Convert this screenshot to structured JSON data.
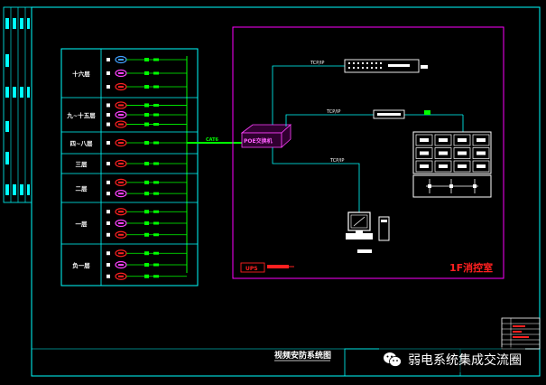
{
  "floors": [
    {
      "label": "十六层"
    },
    {
      "label": "九~十五层"
    },
    {
      "label": "四~八层"
    },
    {
      "label": "三层"
    },
    {
      "label": "二层"
    },
    {
      "label": "一层"
    },
    {
      "label": "负一层"
    }
  ],
  "trunk_label": "CAT6",
  "net_labels": {
    "top": "TCP/IP",
    "middle": "TCP/IP",
    "lower": "TCP/IP"
  },
  "switch_label": "POE交换机",
  "ups_label": "UPS",
  "control_room_label": "1F消控室",
  "drawing_title": "视频安防系统图",
  "watermark": "弱电系统集成交流圈",
  "colors": {
    "cyan": "#00ffff",
    "green": "#00ff00",
    "magenta": "#ff00ff",
    "red": "#ff2020",
    "white": "#ffffff"
  }
}
